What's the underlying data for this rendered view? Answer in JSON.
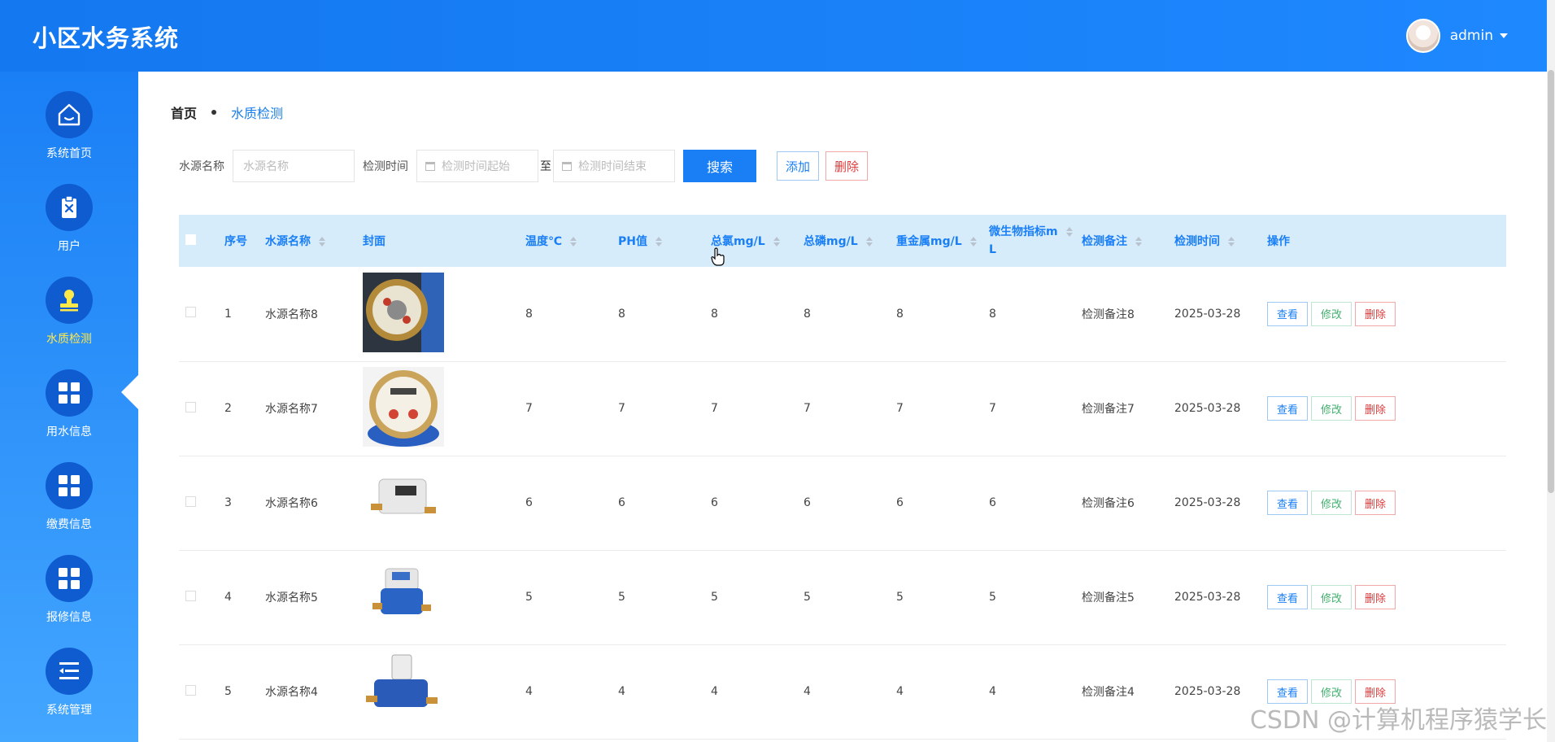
{
  "app": {
    "title": "小区水务系统"
  },
  "user": {
    "name": "admin"
  },
  "nav": [
    {
      "label": "系统首页",
      "icon": "home-icon"
    },
    {
      "label": "用户",
      "icon": "user-clipboard-icon"
    },
    {
      "label": "水质检测",
      "icon": "stamp-icon",
      "active": true
    },
    {
      "label": "用水信息",
      "icon": "grid-icon"
    },
    {
      "label": "缴费信息",
      "icon": "grid-icon"
    },
    {
      "label": "报修信息",
      "icon": "grid-icon"
    },
    {
      "label": "系统管理",
      "icon": "list-icon"
    }
  ],
  "breadcrumb": {
    "home": "首页",
    "current": "水质检测"
  },
  "search": {
    "name_label": "水源名称",
    "name_placeholder": "水源名称",
    "time_label": "检测时间",
    "start_placeholder": "检测时间起始",
    "to_label": "至",
    "end_placeholder": "检测时间结束",
    "search_button": "搜索",
    "add_button": "添加",
    "delete_button": "删除"
  },
  "table": {
    "headers": {
      "index": "序号",
      "name": "水源名称",
      "cover": "封面",
      "temp": "温度℃",
      "ph": "PH值",
      "chlorine": "总氯mg/L",
      "phosphorus": "总磷mg/L",
      "heavy_metal": "重金属mg/L",
      "microbe_1": "微生物指标m",
      "microbe_2": "L",
      "note": "检测备注",
      "time": "检测时间",
      "ops": "操作"
    },
    "rows": [
      {
        "index": "1",
        "name": "水源名称8",
        "temp": "8",
        "ph": "8",
        "chlorine": "8",
        "phosphorus": "8",
        "heavy_metal": "8",
        "microbe": "8",
        "note": "检测备注8",
        "time": "2025-03-28"
      },
      {
        "index": "2",
        "name": "水源名称7",
        "temp": "7",
        "ph": "7",
        "chlorine": "7",
        "phosphorus": "7",
        "heavy_metal": "7",
        "microbe": "7",
        "note": "检测备注7",
        "time": "2025-03-28"
      },
      {
        "index": "3",
        "name": "水源名称6",
        "temp": "6",
        "ph": "6",
        "chlorine": "6",
        "phosphorus": "6",
        "heavy_metal": "6",
        "microbe": "6",
        "note": "检测备注6",
        "time": "2025-03-28"
      },
      {
        "index": "4",
        "name": "水源名称5",
        "temp": "5",
        "ph": "5",
        "chlorine": "5",
        "phosphorus": "5",
        "heavy_metal": "5",
        "microbe": "5",
        "note": "检测备注5",
        "time": "2025-03-28"
      },
      {
        "index": "5",
        "name": "水源名称4",
        "temp": "4",
        "ph": "4",
        "chlorine": "4",
        "phosphorus": "4",
        "heavy_metal": "4",
        "microbe": "4",
        "note": "检测备注4",
        "time": "2025-03-28"
      }
    ],
    "ops": {
      "view": "查看",
      "edit": "修改",
      "delete": "删除"
    }
  },
  "watermark": "CSDN @计算机程序猿学长",
  "colors": {
    "primary": "#1a7ff5",
    "header_bg": "#1478f0",
    "table_head_bg": "#d7ecfb",
    "active_nav": "#ffe94a",
    "danger": "#e03a3a",
    "success": "#43b06f"
  }
}
